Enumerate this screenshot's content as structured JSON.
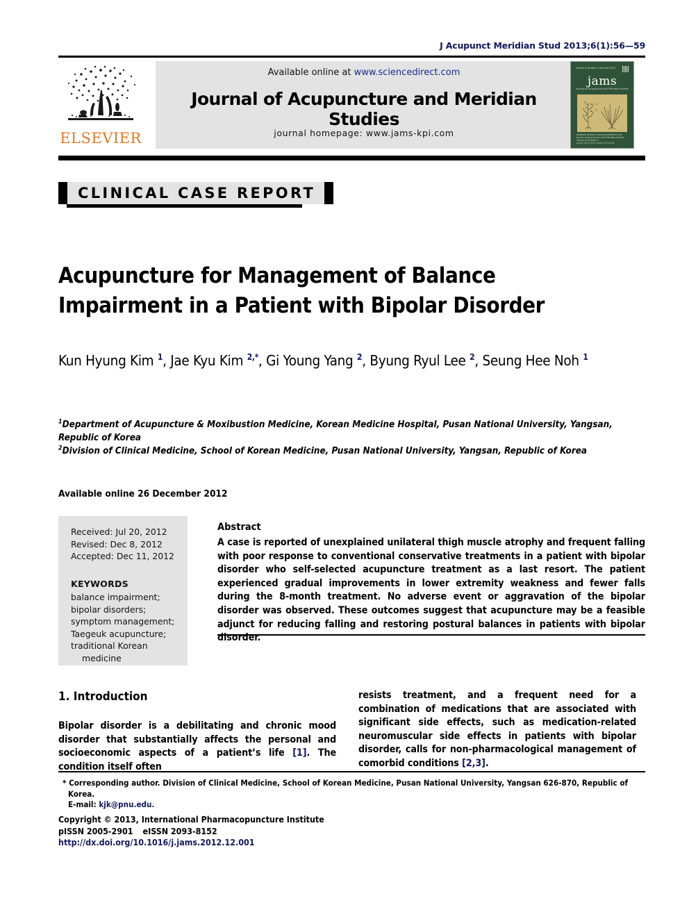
{
  "running_head": "J Acupunct Meridian Stud 2013;6(1):56—59",
  "header": {
    "publisher_name": "ELSEVIER",
    "available_prefix": "Available online at ",
    "available_link": "www.sciencedirect.com",
    "journal_title": "Journal of Acupuncture and Meridian Studies",
    "homepage": "journal homepage: www.jams-kpi.com",
    "cover": {
      "top_line": "Volume 6, Number 1\nFebruary 2013",
      "logo_text": "jams",
      "subtitle": "Journal of Acupuncture\nand Meridian Studies",
      "bottom_text": "Available online at\nwww.sciencedirect.com  Journal of Acupuncture and Meridian Studies\nVolume 6, Number 1",
      "doi_text": "pISSN 2005-2901  eISSN 2093-8152"
    }
  },
  "section_marker": "CLINICAL CASE REPORT",
  "title": "Acupuncture for Management of Balance Impairment in a Patient with Bipolar Disorder",
  "authors": [
    {
      "name": "Kun Hyung Kim",
      "sup": "1",
      "sep": ", "
    },
    {
      "name": "Jae Kyu Kim",
      "sup": "2,*",
      "sep": ", "
    },
    {
      "name": "Gi Young Yang",
      "sup": "2",
      "sep": ", "
    },
    {
      "name": "Byung Ryul Lee",
      "sup": "2",
      "sep": ", "
    },
    {
      "name": "Seung Hee Noh",
      "sup": "1",
      "sep": ""
    }
  ],
  "affiliations": [
    {
      "sup": "1",
      "text": "Department of Acupuncture & Moxibustion Medicine, Korean Medicine Hospital, Pusan National University, Yangsan, Republic of Korea"
    },
    {
      "sup": "2",
      "text": "Division of Clinical Medicine, School of Korean Medicine, Pusan National University, Yangsan, Republic of Korea"
    }
  ],
  "available_online": "Available online 26 December 2012",
  "history": {
    "received": "Received: Jul 20, 2012",
    "revised": "Revised: Dec 8, 2012",
    "accepted": "Accepted: Dec 11, 2012"
  },
  "keywords_heading": "KEYWORDS",
  "keywords": [
    "balance impairment;",
    "bipolar disorders;",
    "symptom management;",
    "Taegeuk acupuncture;",
    "traditional Korean"
  ],
  "keywords_last_indent": "medicine",
  "abstract": {
    "heading": "Abstract",
    "text": "A case is reported of unexplained unilateral thigh muscle atrophy and frequent falling with poor response to conventional conservative treatments in a patient with bipolar disorder who self-selected acupuncture treatment as a last resort. The patient experienced gradual improvements in lower extremity weakness and fewer falls during the 8-month treatment. No adverse event or aggravation of the bipolar disorder was observed. These outcomes suggest that acupuncture may be a feasible adjunct for reducing falling and restoring postural balances in patients with bipolar disorder."
  },
  "body": {
    "section_heading": "1. Introduction",
    "left_col": {
      "part1": "Bipolar disorder is a debilitating and chronic mood disorder that substantially affects the personal and socioeconomic aspects of a patient’s life ",
      "cite1": "[1]",
      "part2": ". The condition itself often"
    },
    "right_col": {
      "part1": "resists treatment, and a frequent need for a combination of medications that are associated with significant side effects, such as medication-related neuromuscular side effects in patients with bipolar disorder, calls for non-pharmacological management of comorbid conditions ",
      "cite1": "[2,3]",
      "part2": "."
    }
  },
  "footnote": {
    "corresponding": "* Corresponding author. Division of Clinical Medicine, School of Korean Medicine, Pusan National University, Yangsan 626-870, Republic of Korea.",
    "email_label": "E-mail: ",
    "email": "kjk@pnu.edu."
  },
  "copyright": {
    "line": "Copyright © 2013, International Pharmacopuncture Institute",
    "pissn": "pISSN 2005-2901",
    "eissn": "eISSN 2093-8152",
    "doi": "http://dx.doi.org/10.1016/j.jams.2012.12.001"
  },
  "colors": {
    "navy": "#12195c",
    "elsevier_orange": "#e87722",
    "band_grey": "#e3e3e3",
    "cover_green": "#2f5339",
    "cover_tan": "#cdb978"
  }
}
